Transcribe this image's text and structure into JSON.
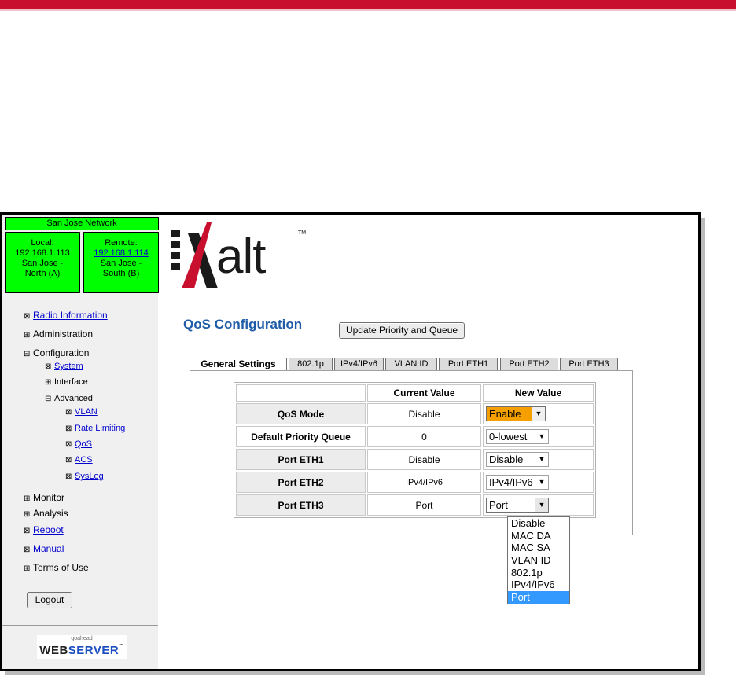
{
  "network": {
    "title": "San Jose Network",
    "local_label": "Local:",
    "local_ip": "192.168.1.113",
    "local_site": "San Jose -",
    "local_side": "North (A)",
    "remote_label": "Remote:",
    "remote_ip": "192.168.1.114",
    "remote_site": "San Jose -",
    "remote_side": "South (B)"
  },
  "nav": {
    "radio_information": "Radio Information",
    "administration": "Administration",
    "configuration": "Configuration",
    "system": "System",
    "interface": "Interface",
    "advanced": "Advanced",
    "vlan": "VLAN",
    "rate_limiting": "Rate Limiting",
    "qos": "QoS",
    "acs": "ACS",
    "syslog": "SysLog",
    "monitor": "Monitor",
    "analysis": "Analysis",
    "reboot": "Reboot",
    "manual": "Manual",
    "terms_of_use": "Terms of Use",
    "logout": "Logout"
  },
  "webserver": {
    "small": "goahead",
    "word1": "WEB",
    "word2": "SERVER",
    "tm": "™"
  },
  "logo": {
    "text": "alt",
    "tm": "TM"
  },
  "page": {
    "title": "QoS Configuration",
    "update_button": "Update Priority and Queue"
  },
  "tabs": [
    "General Settings",
    "802.1p",
    "IPv4/IPv6",
    "VLAN ID",
    "Port ETH1",
    "Port ETH2",
    "Port ETH3"
  ],
  "table": {
    "header_current": "Current Value",
    "header_new": "New Value",
    "rows": [
      {
        "label": "QoS Mode",
        "current": "Disable",
        "new": "Enable"
      },
      {
        "label": "Default Priority Queue",
        "current": "0",
        "new": "0-lowest"
      },
      {
        "label": "Port ETH1",
        "current": "Disable",
        "new": "Disable"
      },
      {
        "label": "Port ETH2",
        "current": "IPv4/IPv6",
        "new": "IPv4/IPv6"
      },
      {
        "label": "Port ETH3",
        "current": "Port",
        "new": "Port"
      }
    ]
  },
  "dropdown_options": [
    "Disable",
    "MAC DA",
    "MAC SA",
    "VLAN ID",
    "802.1p",
    "IPv4/IPv6",
    "Port"
  ],
  "colors": {
    "accent": "#c8102e",
    "title": "#1e5ca8",
    "network_bg": "#00ff00",
    "highlight": "#3399ff",
    "enable_bg": "#f5a000"
  }
}
